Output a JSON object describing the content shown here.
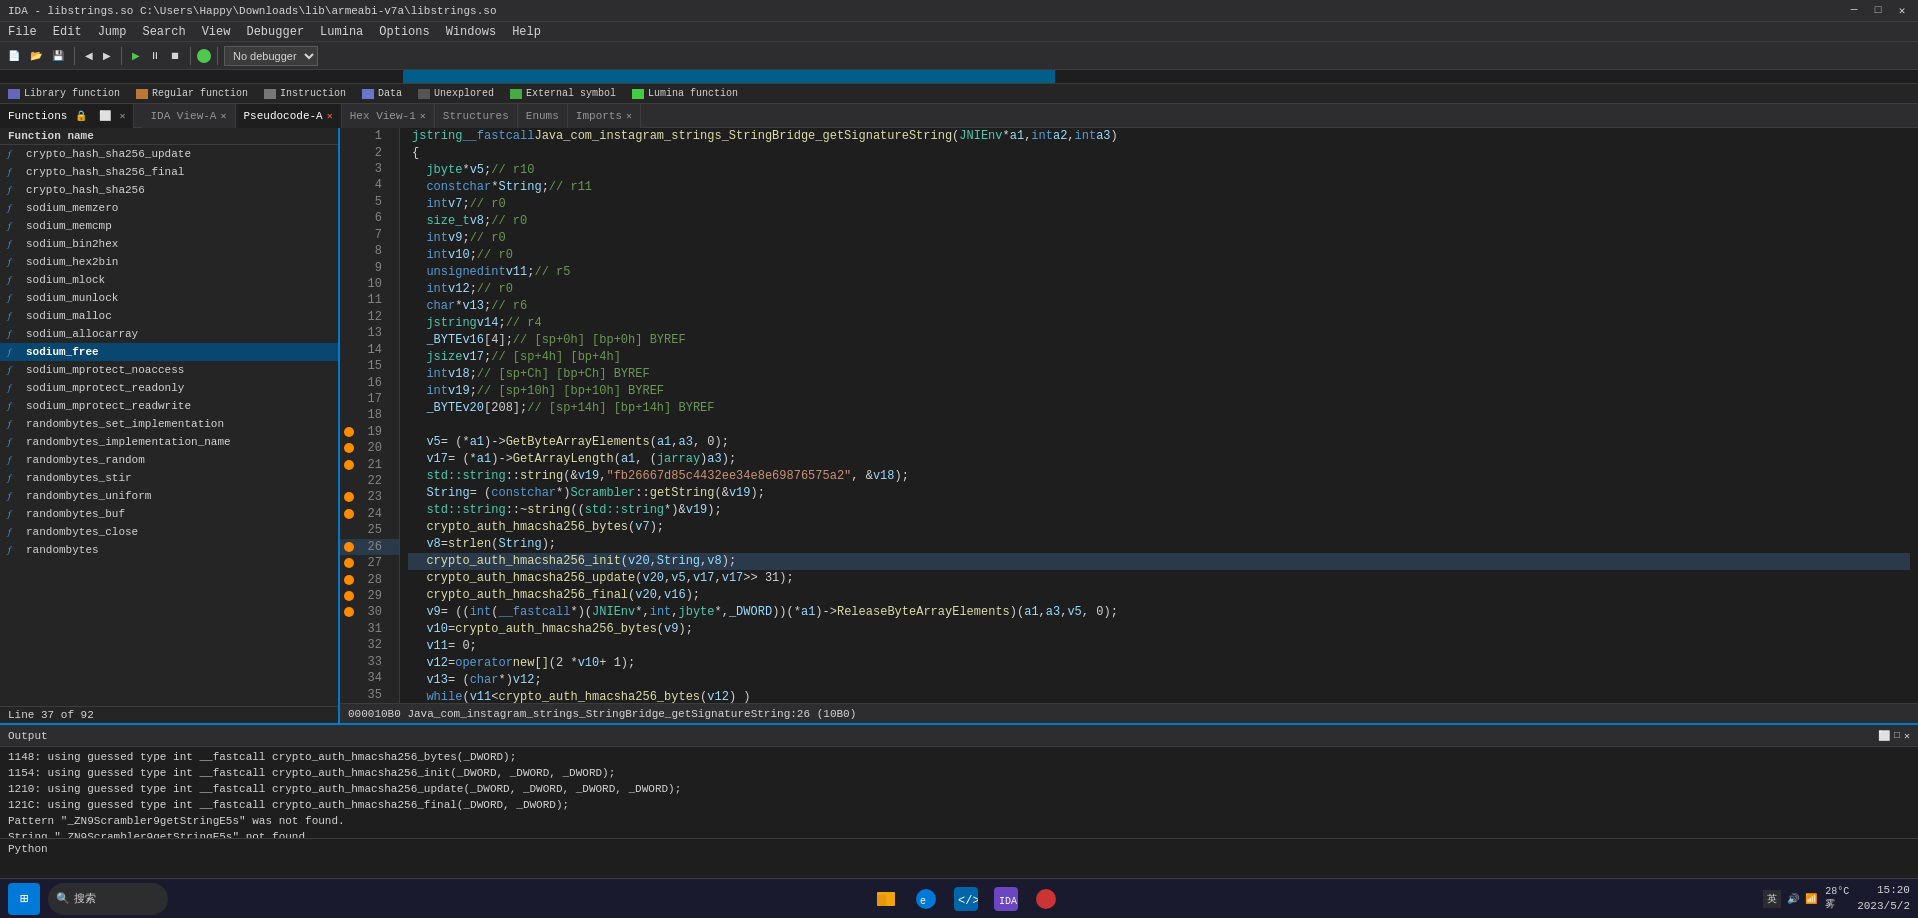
{
  "titlebar": {
    "title": "IDA - libstrings.so C:\\Users\\Happy\\Downloads\\lib\\armeabi-v7a\\libstrings.so",
    "minimize": "─",
    "maximize": "□",
    "close": "✕"
  },
  "menubar": {
    "items": [
      "File",
      "Edit",
      "Jump",
      "Search",
      "View",
      "Debugger",
      "Lumina",
      "Options",
      "Windows",
      "Help"
    ]
  },
  "legend": {
    "items": [
      {
        "label": "Library function",
        "color": "#6666cc"
      },
      {
        "label": "Regular function",
        "color": "#cc8844"
      },
      {
        "label": "Instruction",
        "color": "#888888"
      },
      {
        "label": "Data",
        "color": "#8888cc"
      },
      {
        "label": "Unexplored",
        "color": "#888888"
      },
      {
        "label": "External symbol",
        "color": "#44aa44"
      },
      {
        "label": "Lumina function",
        "color": "#44cc44"
      }
    ]
  },
  "tabs": {
    "ida_view": "IDA View-A",
    "pseudocode": "Pseudocode-A",
    "hex_view": "Hex View-1",
    "structures": "Structures",
    "enums": "Enums",
    "imports": "Imports"
  },
  "functions_panel": {
    "title": "Functions",
    "column": "Function name",
    "items": [
      "crypto_hash_sha256_update",
      "crypto_hash_sha256_final",
      "crypto_hash_sha256",
      "sodium_memzero",
      "sodium_memcmp",
      "sodium_bin2hex",
      "sodium_hex2bin",
      "sodium_mlock",
      "sodium_munlock",
      "sodium_malloc",
      "sodium_allocarray",
      "sodium_free",
      "sodium_mprotect_noaccess",
      "sodium_mprotect_readonly",
      "sodium_mprotect_readwrite",
      "randombytes_set_implementation",
      "randombytes_implementation_name",
      "randombytes_random",
      "randombytes_stir",
      "randombytes_uniform",
      "randombytes_buf",
      "randombytes_close",
      "randombytes"
    ],
    "selected": "sodium_free"
  },
  "code": {
    "function_header": "jstring __fastcall Java_com_instagram_strings_StringBridge_getSignatureString(JNIEnv *a1, int a2, int a3)",
    "lines": [
      {
        "num": 1,
        "dot": false,
        "text": "jstring __fastcall Java_com_instagram_strings_StringBridge_getSignatureString(JNIEnv *a1, int a2, int a3)",
        "highlighted": false
      },
      {
        "num": 2,
        "dot": false,
        "text": "{",
        "highlighted": false
      },
      {
        "num": 3,
        "dot": false,
        "text": "  jbyte *v5; // r10",
        "highlighted": false
      },
      {
        "num": 4,
        "dot": false,
        "text": "  const char *String; // r11",
        "highlighted": false
      },
      {
        "num": 5,
        "dot": false,
        "text": "  int v7; // r0",
        "highlighted": false
      },
      {
        "num": 6,
        "dot": false,
        "text": "  size_t v8; // r0",
        "highlighted": false
      },
      {
        "num": 7,
        "dot": false,
        "text": "  int v9; // r0",
        "highlighted": false
      },
      {
        "num": 8,
        "dot": false,
        "text": "  int v10; // r0",
        "highlighted": false
      },
      {
        "num": 9,
        "dot": false,
        "text": "  unsigned int v11; // r5",
        "highlighted": false
      },
      {
        "num": 10,
        "dot": false,
        "text": "  int v12; // r0",
        "highlighted": false
      },
      {
        "num": 11,
        "dot": false,
        "text": "  char *v13; // r6",
        "highlighted": false
      },
      {
        "num": 12,
        "dot": false,
        "text": "  jstring v14; // r4",
        "highlighted": false
      },
      {
        "num": 13,
        "dot": false,
        "text": "  _BYTE v16[4]; // [sp+0h] [bp+0h] BYREF",
        "highlighted": false
      },
      {
        "num": 14,
        "dot": false,
        "text": "  jsize v17; // [sp+4h] [bp+4h]",
        "highlighted": false
      },
      {
        "num": 15,
        "dot": false,
        "text": "  int v18; // [sp+Ch] [bp+Ch] BYREF",
        "highlighted": false
      },
      {
        "num": 16,
        "dot": false,
        "text": "  int v19; // [sp+10h] [bp+10h] BYREF",
        "highlighted": false
      },
      {
        "num": 17,
        "dot": false,
        "text": "  _BYTE v20[208]; // [sp+14h] [bp+14h] BYREF",
        "highlighted": false
      },
      {
        "num": 18,
        "dot": false,
        "text": "",
        "highlighted": false
      },
      {
        "num": 19,
        "dot": true,
        "text": "  v5 = (*a1)->GetByteArrayElements(a1, a3, 0);",
        "highlighted": false
      },
      {
        "num": 20,
        "dot": true,
        "text": "  v17 = (*a1)->GetArrayLength(a1, (jarray)a3);",
        "highlighted": false
      },
      {
        "num": 21,
        "dot": true,
        "text": "  std::string::string(&v19, \"fb26667d85c4432ee34e8e69876575a2\", &v18);",
        "highlighted": false
      },
      {
        "num": 22,
        "dot": false,
        "text": "  String = (const char *)Scrambler::getString(&v19);",
        "highlighted": false
      },
      {
        "num": 23,
        "dot": true,
        "text": "  std::string::~string((std::string *)&v19);",
        "highlighted": false
      },
      {
        "num": 24,
        "dot": true,
        "text": "  crypto_auth_hmacsha256_bytes(v7);",
        "highlighted": false
      },
      {
        "num": 25,
        "dot": false,
        "text": "  v8 = strlen(String);",
        "highlighted": false
      },
      {
        "num": 26,
        "dot": true,
        "text": "  crypto_auth_hmacsha256_init(v20, String, v8);",
        "highlighted": true,
        "selected": true
      },
      {
        "num": 27,
        "dot": true,
        "text": "  crypto_auth_hmacsha256_update(v20, v5, v17, v17 >> 31);",
        "highlighted": false
      },
      {
        "num": 28,
        "dot": true,
        "text": "  crypto_auth_hmacsha256_final(v20, v16);",
        "highlighted": false
      },
      {
        "num": 29,
        "dot": true,
        "text": "  v9 = ((int (__fastcall *)(JNIEnv *, int, jbyte *, _DWORD))(*a1)->ReleaseByteArrayElements)(a1, a3, v5, 0);",
        "highlighted": false
      },
      {
        "num": 30,
        "dot": true,
        "text": "  v10 = crypto_auth_hmacsha256_bytes(v9);",
        "highlighted": false
      },
      {
        "num": 31,
        "dot": false,
        "text": "  v11 = 0;",
        "highlighted": false
      },
      {
        "num": 32,
        "dot": false,
        "text": "  v12 = operator new[](2 * v10 + 1);",
        "highlighted": false
      },
      {
        "num": 33,
        "dot": false,
        "text": "  v13 = (char *)v12;",
        "highlighted": false
      },
      {
        "num": 34,
        "dot": false,
        "text": "  while ( v11 < crypto_auth_hmacsha256_bytes(v12) )",
        "highlighted": false
      },
      {
        "num": 35,
        "dot": false,
        "text": "  {",
        "highlighted": false
      }
    ]
  },
  "status_bar": {
    "text": "Line 37 of 92"
  },
  "bottom_status": {
    "text": "000010B0 Java_com_instagram_strings_StringBridge_getSignatureString:26 (10B0)"
  },
  "output": {
    "title": "Output",
    "lines": [
      "1148: using guessed type int __fastcall crypto_auth_hmacsha256_bytes(_DWORD);",
      "1154: using guessed type int __fastcall crypto_auth_hmacsha256_init(_DWORD, _DWORD, _DWORD);",
      "1210: using guessed type int __fastcall crypto_auth_hmacsha256_update(_DWORD, _DWORD, _DWORD, _DWORD);",
      "121C: using guessed type int __fastcall crypto_auth_hmacsha256_final(_DWORD, _DWORD);",
      "Pattern \"_ZN9Scrambler9getStringE5s\" was not found.",
      "String \"_ZN9Scrambler9getStringE5s\" not found"
    ],
    "python_label": "Python"
  },
  "debugger": {
    "label": "No debugger"
  },
  "taskbar": {
    "weather": "28°C\n雾",
    "time": "15:20",
    "date": "2023/5/2",
    "search_placeholder": "搜索",
    "lang": "英"
  }
}
